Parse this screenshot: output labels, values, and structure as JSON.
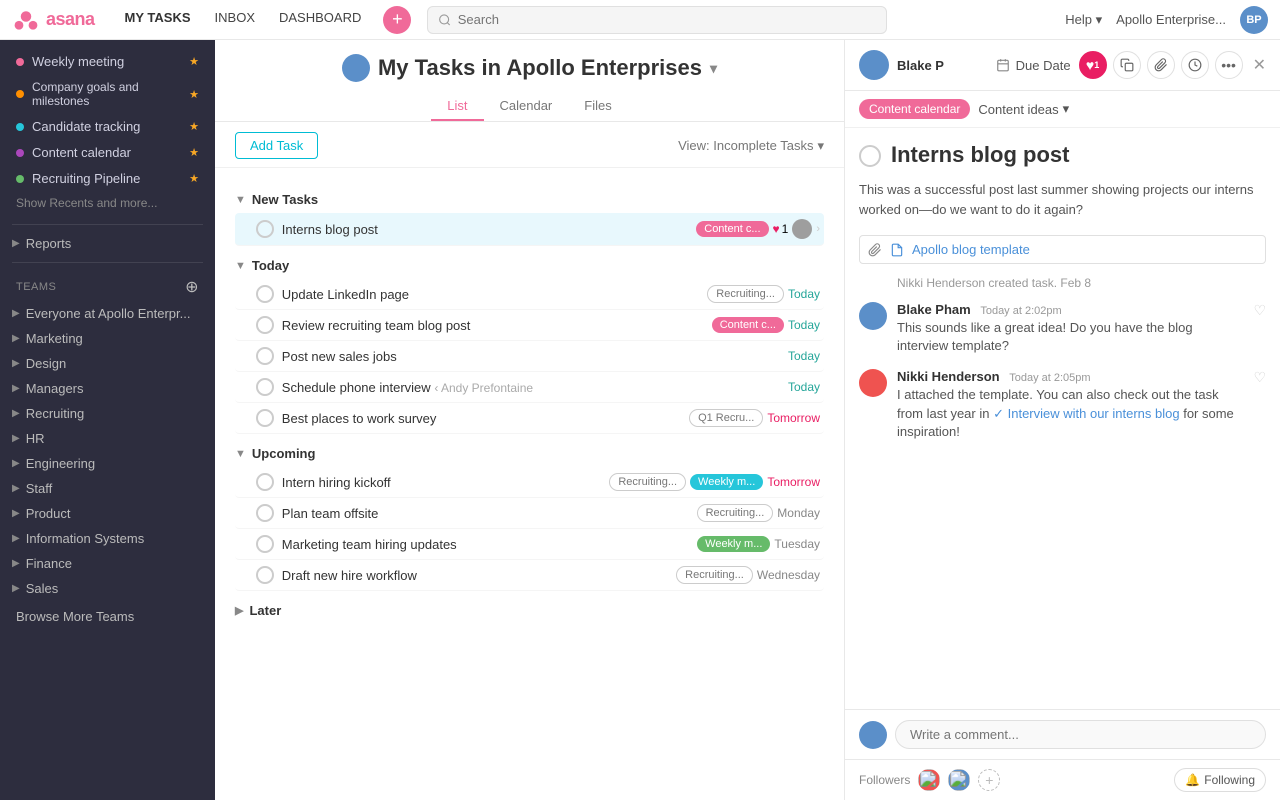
{
  "app": {
    "name": "asana",
    "logo_text": "asana"
  },
  "topnav": {
    "links": [
      "MY TASKS",
      "INBOX",
      "DASHBOARD"
    ],
    "active_link": "MY TASKS",
    "search_placeholder": "Search",
    "help_label": "Help",
    "enterprise_label": "Apollo Enterprise...",
    "plus_icon": "+"
  },
  "sidebar": {
    "recents": [
      {
        "label": "Weekly meeting",
        "color": "#f06a99",
        "starred": true
      },
      {
        "label": "Company goals and milestones",
        "color": "#ff8f00",
        "starred": true
      },
      {
        "label": "Candidate tracking",
        "color": "#26c6da",
        "starred": true
      },
      {
        "label": "Content calendar",
        "color": "#ab47bc",
        "starred": true
      },
      {
        "label": "Recruiting Pipeline",
        "color": "#66bb6a",
        "starred": true
      }
    ],
    "show_recents_label": "Show Recents and more...",
    "reports_label": "Reports",
    "teams_label": "Teams",
    "teams_list": [
      "Everyone at Apollo Enterpr...",
      "Marketing",
      "Design",
      "Managers",
      "Recruiting",
      "HR",
      "Engineering",
      "Staff",
      "Product",
      "Information Systems",
      "Finance",
      "Sales"
    ],
    "browse_teams_label": "Browse More Teams"
  },
  "task_panel": {
    "title": "My Tasks in Apollo Enterprises",
    "title_chevron": "▾",
    "tabs": [
      "List",
      "Calendar",
      "Files"
    ],
    "active_tab": "List",
    "add_task_label": "Add Task",
    "view_filter_label": "View: Incomplete Tasks",
    "sections": {
      "new_tasks": {
        "label": "New Tasks",
        "tasks": [
          {
            "name": "Interns blog post",
            "tag": "Content c...",
            "tag_color": "tag-pink",
            "hearts": "1",
            "has_heart": true,
            "has_avatar": true,
            "has_chevron": true,
            "highlighted": true
          }
        ]
      },
      "today": {
        "label": "Today",
        "tasks": [
          {
            "name": "Update LinkedIn page",
            "tag": "Recruiting...",
            "tag_color": "tag-outline",
            "date": "Today",
            "date_class": "date-today"
          },
          {
            "name": "Review recruiting team blog post",
            "tag": "Content c...",
            "tag_color": "tag-pink",
            "date": "Today",
            "date_class": "date-today"
          },
          {
            "name": "Post new sales jobs",
            "tag": "",
            "date": "Today",
            "date_class": "date-today"
          },
          {
            "name": "Schedule phone interview",
            "collaborator": "‹ Andy Prefontaine",
            "tag": "",
            "date": "Today",
            "date_class": "date-today"
          },
          {
            "name": "Best places to work survey",
            "tag": "Q1 Recru...",
            "tag_color": "tag-outline",
            "date": "Tomorrow",
            "date_class": "date-tomorrow"
          }
        ]
      },
      "upcoming": {
        "label": "Upcoming",
        "tasks": [
          {
            "name": "Intern hiring kickoff",
            "tag": "Recruiting...",
            "tag_color": "tag-outline",
            "tag2": "Weekly m...",
            "tag2_color": "tag-teal",
            "date": "Tomorrow",
            "date_class": "date-tomorrow"
          },
          {
            "name": "Plan team offsite",
            "tag": "Recruiting...",
            "tag_color": "tag-outline",
            "date": "Monday",
            "date_class": "date-weekday"
          },
          {
            "name": "Marketing team hiring updates",
            "tag": "Weekly m...",
            "tag_color": "tag-green",
            "date": "Tuesday",
            "date_class": "date-weekday"
          },
          {
            "name": "Draft new hire workflow",
            "tag": "Recruiting...",
            "tag_color": "tag-outline",
            "date": "Wednesday",
            "date_class": "date-weekday"
          }
        ]
      },
      "later": {
        "label": "Later",
        "collapsed": true
      }
    }
  },
  "detail_panel": {
    "assignee": "Blake P",
    "due_date_label": "Due Date",
    "task_title": "Interns blog post",
    "description": "This was a successful post last summer showing projects our interns worked on—do we want to do it again?",
    "project_tag": "Content calendar",
    "section_tag": "Content ideas",
    "attachment": {
      "icon": "📄",
      "label": "Apollo blog template",
      "clip_icon": "📎"
    },
    "system_note": "Nikki Henderson created task.  Feb 8",
    "comments": [
      {
        "author": "Blake Pham",
        "time": "Today at 2:02pm",
        "text": "This sounds like a great idea! Do you have the blog interview template?",
        "avatar_color": "#5b8fc9"
      },
      {
        "author": "Nikki Henderson",
        "time": "Today at 2:05pm",
        "text_before": "I attached the template. You can also check out the task from last year in ",
        "link": "Interview with our interns blog",
        "text_after": " for some inspiration!",
        "avatar_color": "#ef5350"
      }
    ],
    "comment_placeholder": "Write a comment...",
    "followers_label": "Followers",
    "following_label": "Following",
    "actions": {
      "heart_count": "1",
      "heart_active": true
    }
  }
}
